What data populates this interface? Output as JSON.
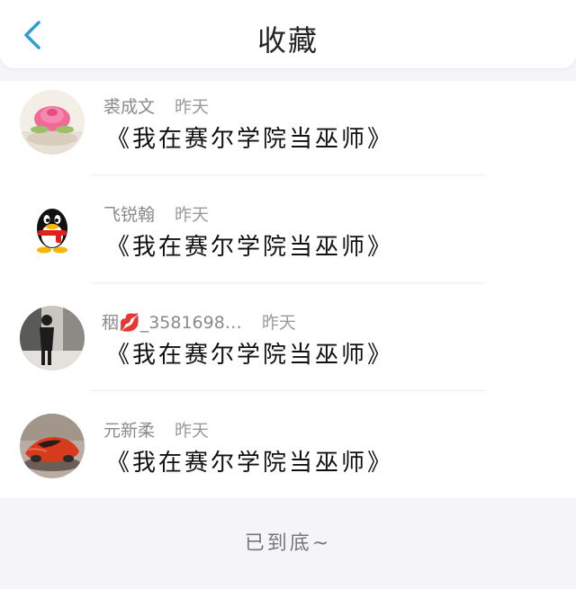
{
  "header": {
    "title": "收藏",
    "back_icon": "chevron-left-icon",
    "accent_color": "#2f9bd9"
  },
  "items": [
    {
      "author": "裘成文",
      "time": "昨天",
      "title": "《我在赛尔学院当巫师》",
      "avatar": "rose-cake-avatar"
    },
    {
      "author": "飞锐翰",
      "time": "昨天",
      "title": "《我在赛尔学院当巫师》",
      "avatar": "qq-penguin-avatar"
    },
    {
      "author_prefix": "秵",
      "author_emoji": "💋",
      "author": "_3581698…",
      "time": "昨天",
      "title": "《我在赛尔学院当巫师》",
      "avatar": "person-photo-avatar"
    },
    {
      "author": "元新柔",
      "time": "昨天",
      "title": "《我在赛尔学院当巫师》",
      "avatar": "red-car-avatar"
    }
  ],
  "footer": {
    "end_text": "已到底~"
  }
}
